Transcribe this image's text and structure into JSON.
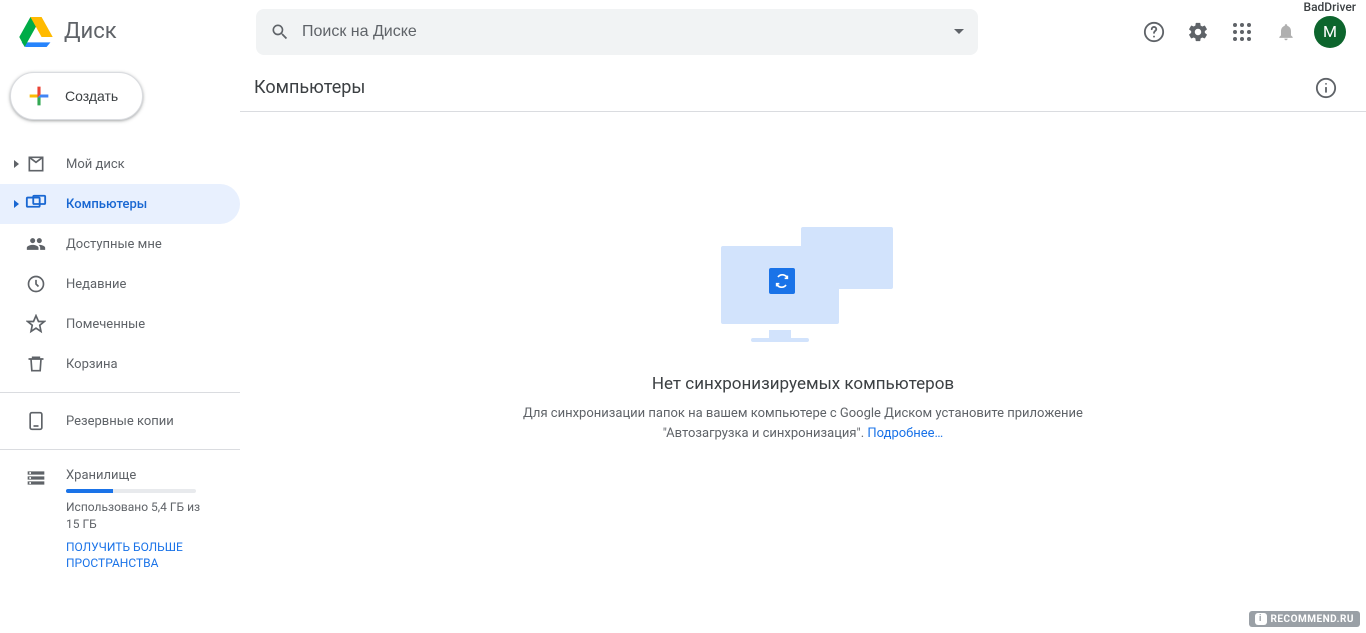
{
  "header": {
    "app_name": "Диск",
    "search_placeholder": "Поиск на Диске",
    "avatar_letter": "M",
    "topright_name": "BadDriver"
  },
  "sidebar": {
    "create_label": "Создать",
    "items": [
      {
        "label": "Мой диск",
        "icon": "my-drive",
        "has_caret": true
      },
      {
        "label": "Компьютеры",
        "icon": "computers",
        "has_caret": true,
        "active": true
      },
      {
        "label": "Доступные мне",
        "icon": "shared",
        "has_caret": false
      },
      {
        "label": "Недавние",
        "icon": "recent",
        "has_caret": false
      },
      {
        "label": "Помеченные",
        "icon": "starred",
        "has_caret": false
      },
      {
        "label": "Корзина",
        "icon": "trash",
        "has_caret": false
      }
    ],
    "backups_label": "Резервные копии",
    "storage": {
      "title": "Хранилище",
      "used_text": "Использовано 5,4 ГБ из 15 ГБ",
      "upgrade_link": "ПОЛУЧИТЬ БОЛЬШЕ ПРОСТРАНСТВА",
      "percent": 36
    }
  },
  "main": {
    "title": "Компьютеры",
    "empty_heading": "Нет синхронизируемых компьютеров",
    "empty_text": "Для синхронизации папок на вашем компьютере с Google Диском установите приложение \"Автозагрузка и синхронизация\". ",
    "learn_more": "Подробнее…"
  },
  "watermark": "RECOMMEND.RU"
}
